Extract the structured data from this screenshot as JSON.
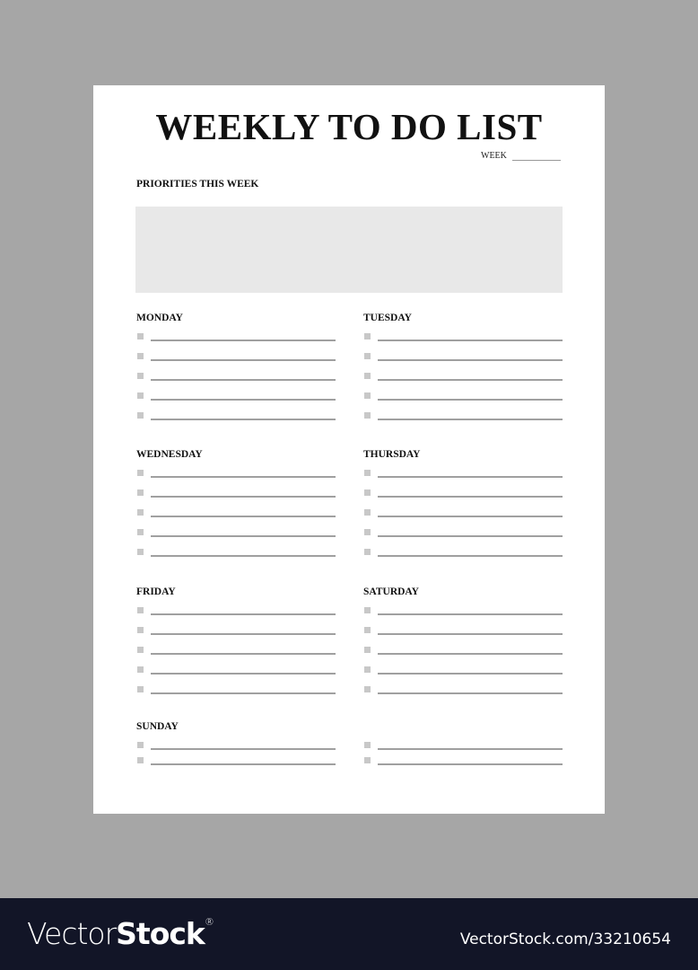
{
  "document": {
    "title": "WEEKLY TO DO LIST",
    "week_label": "WEEK",
    "priorities_label": "PRIORITIES THIS WEEK"
  },
  "days": [
    {
      "name": "MONDAY",
      "rows": 5
    },
    {
      "name": "TUESDAY",
      "rows": 5
    },
    {
      "name": "WEDNESDAY",
      "rows": 5
    },
    {
      "name": "THURSDAY",
      "rows": 5
    },
    {
      "name": "FRIDAY",
      "rows": 5
    },
    {
      "name": "SATURDAY",
      "rows": 5
    },
    {
      "name": "SUNDAY",
      "rows": 2
    },
    {
      "name": "",
      "rows": 2
    }
  ],
  "footer": {
    "logo_light": "Vector",
    "logo_bold": "Stock",
    "logo_mark": "®",
    "url": "VectorStock.com/33210654"
  }
}
